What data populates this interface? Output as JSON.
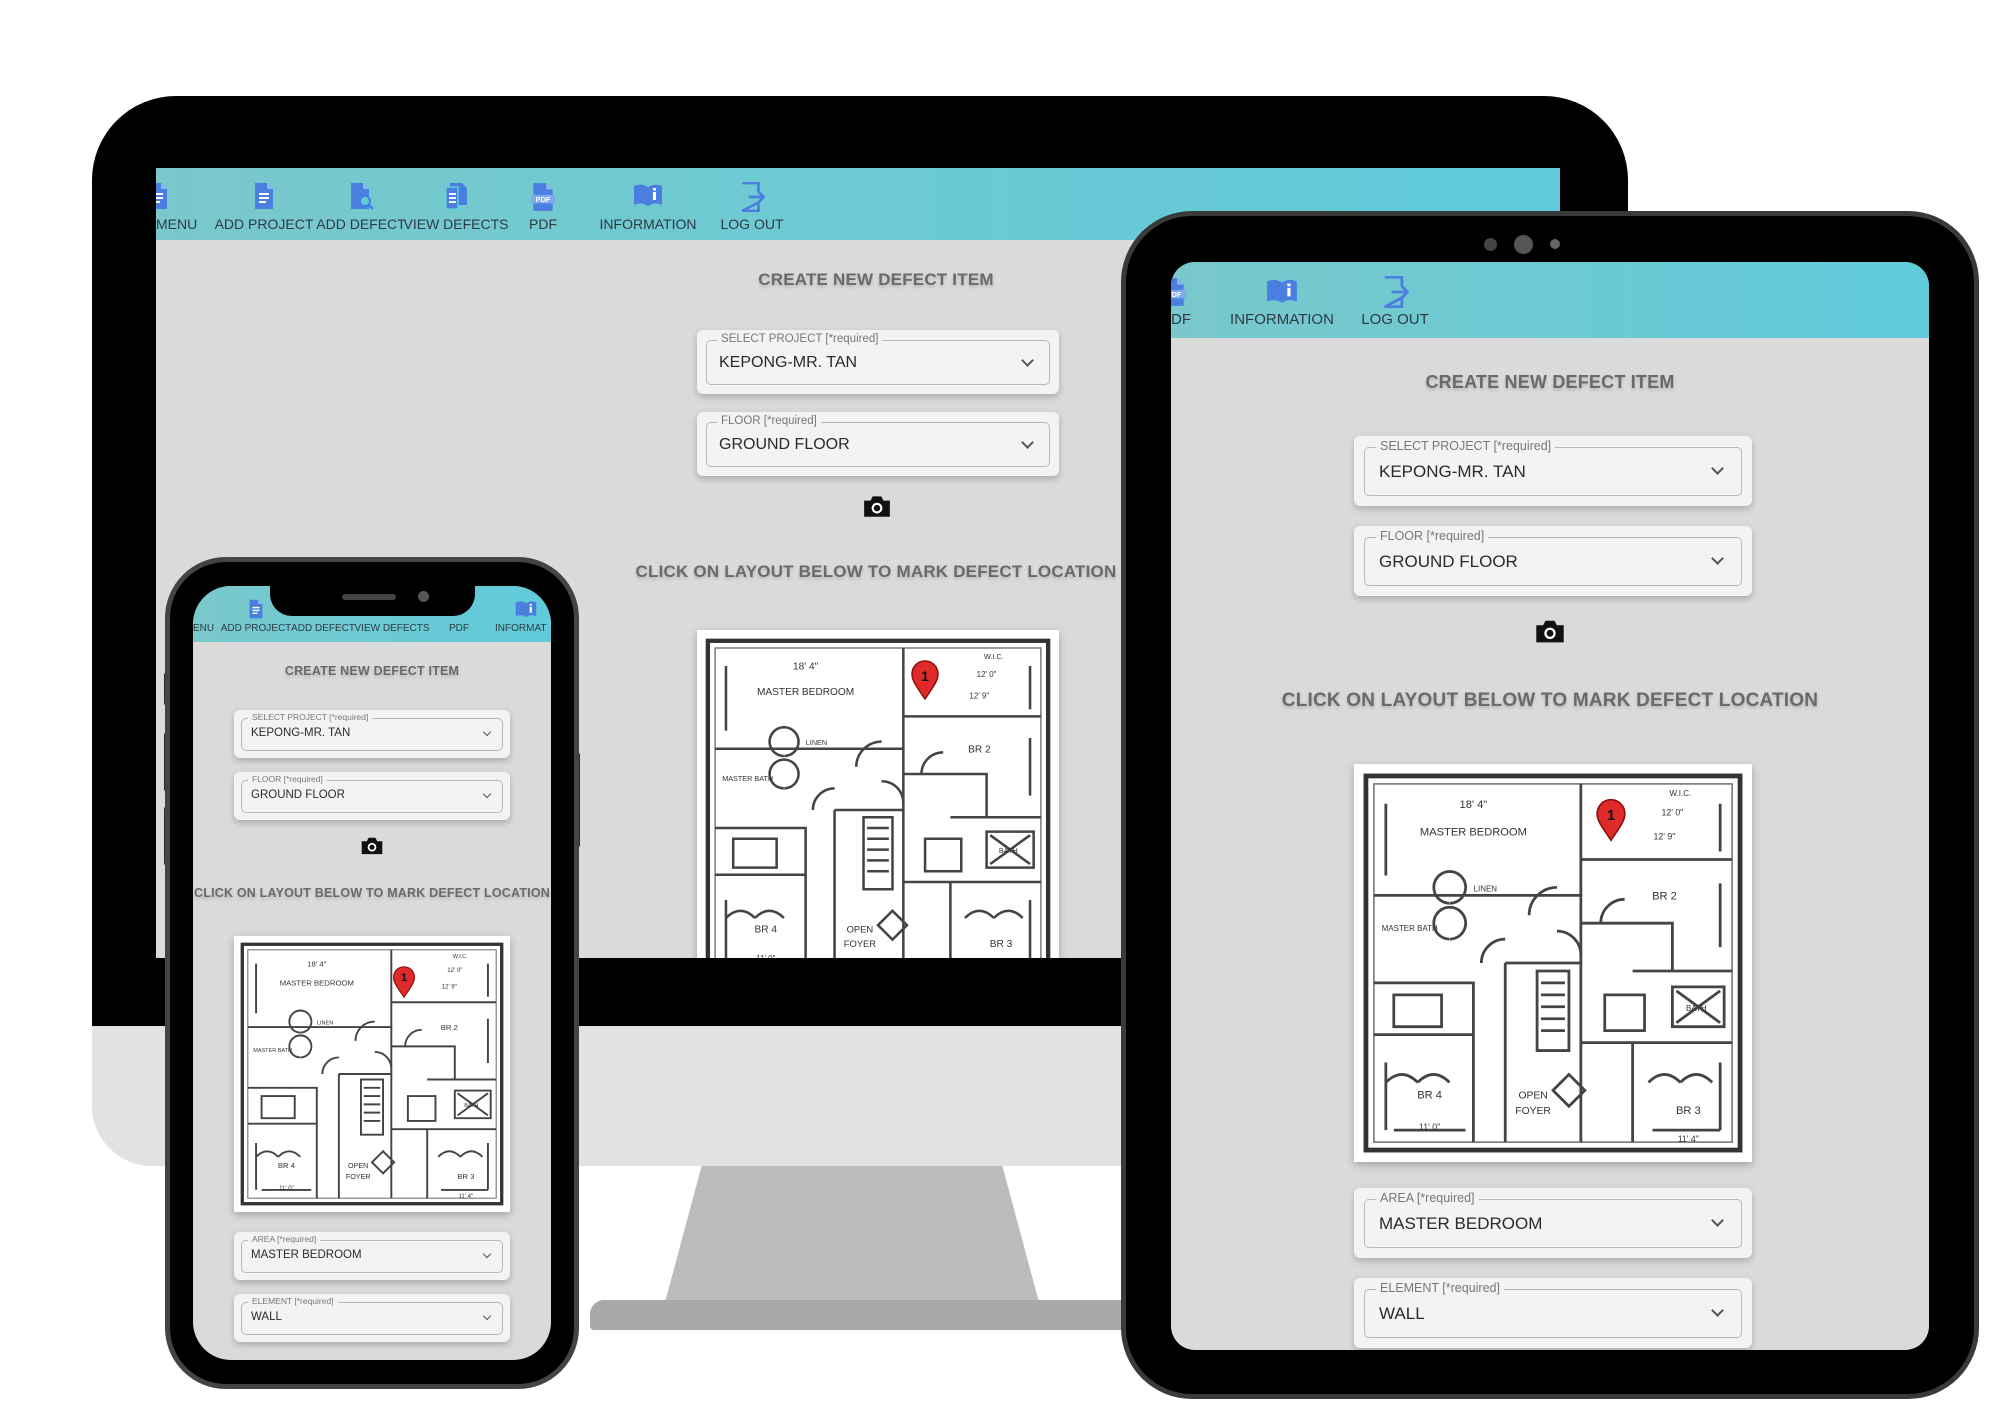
{
  "nav": {
    "menu": "MENU",
    "menu_cut": "ENU",
    "add_project": "ADD PROJECT",
    "add_defect": "ADD DEFECT",
    "view_defects": "VIEW DEFECTS",
    "pdf": "PDF",
    "pdf_cut": "DF",
    "information": "INFORMATION",
    "information_cut": "INFORMAT",
    "log_out": "LOG OUT"
  },
  "form": {
    "heading": "CREATE NEW DEFECT ITEM",
    "project_label": "SELECT PROJECT [*required]",
    "project_value": "KEPONG-MR. TAN",
    "floor_label": "FLOOR [*required]",
    "floor_value": "GROUND FLOOR",
    "layout_instruction": "CLICK ON LAYOUT BELOW TO MARK DEFECT LOCATION",
    "area_label": "AREA [*required]",
    "area_value": "MASTER BEDROOM",
    "element_label": "ELEMENT [*required]",
    "element_value": "WALL",
    "pin_number": "1"
  },
  "plan": {
    "master_bedroom": "MASTER BEDROOM",
    "master_bath": "MASTER BATH",
    "linen": "LINEN",
    "wic": "W.I.C.",
    "br2": "BR 2",
    "br3": "BR 3",
    "br4": "BR 4",
    "open": "OPEN",
    "foyer": "FOYER",
    "bath": "BATH",
    "dim_a": "18' 4\"",
    "dim_b": "12' 0\"",
    "dim_c": "12' 9\"",
    "dim_d": "11' 0\"",
    "dim_e": "11' 4\""
  },
  "colors": {
    "nav_gradient_start": "#79c8cb",
    "nav_gradient_end": "#5fcbdb",
    "nav_icon": "#4a7fe0",
    "pin": "#e02a2a",
    "screen_bg": "#dadada"
  },
  "icons": [
    "menu-icon",
    "add-project-icon",
    "add-defect-icon",
    "view-defects-icon",
    "pdf-icon",
    "information-icon",
    "log-out-icon",
    "camera-icon",
    "chevron-down-icon",
    "map-pin-icon"
  ]
}
